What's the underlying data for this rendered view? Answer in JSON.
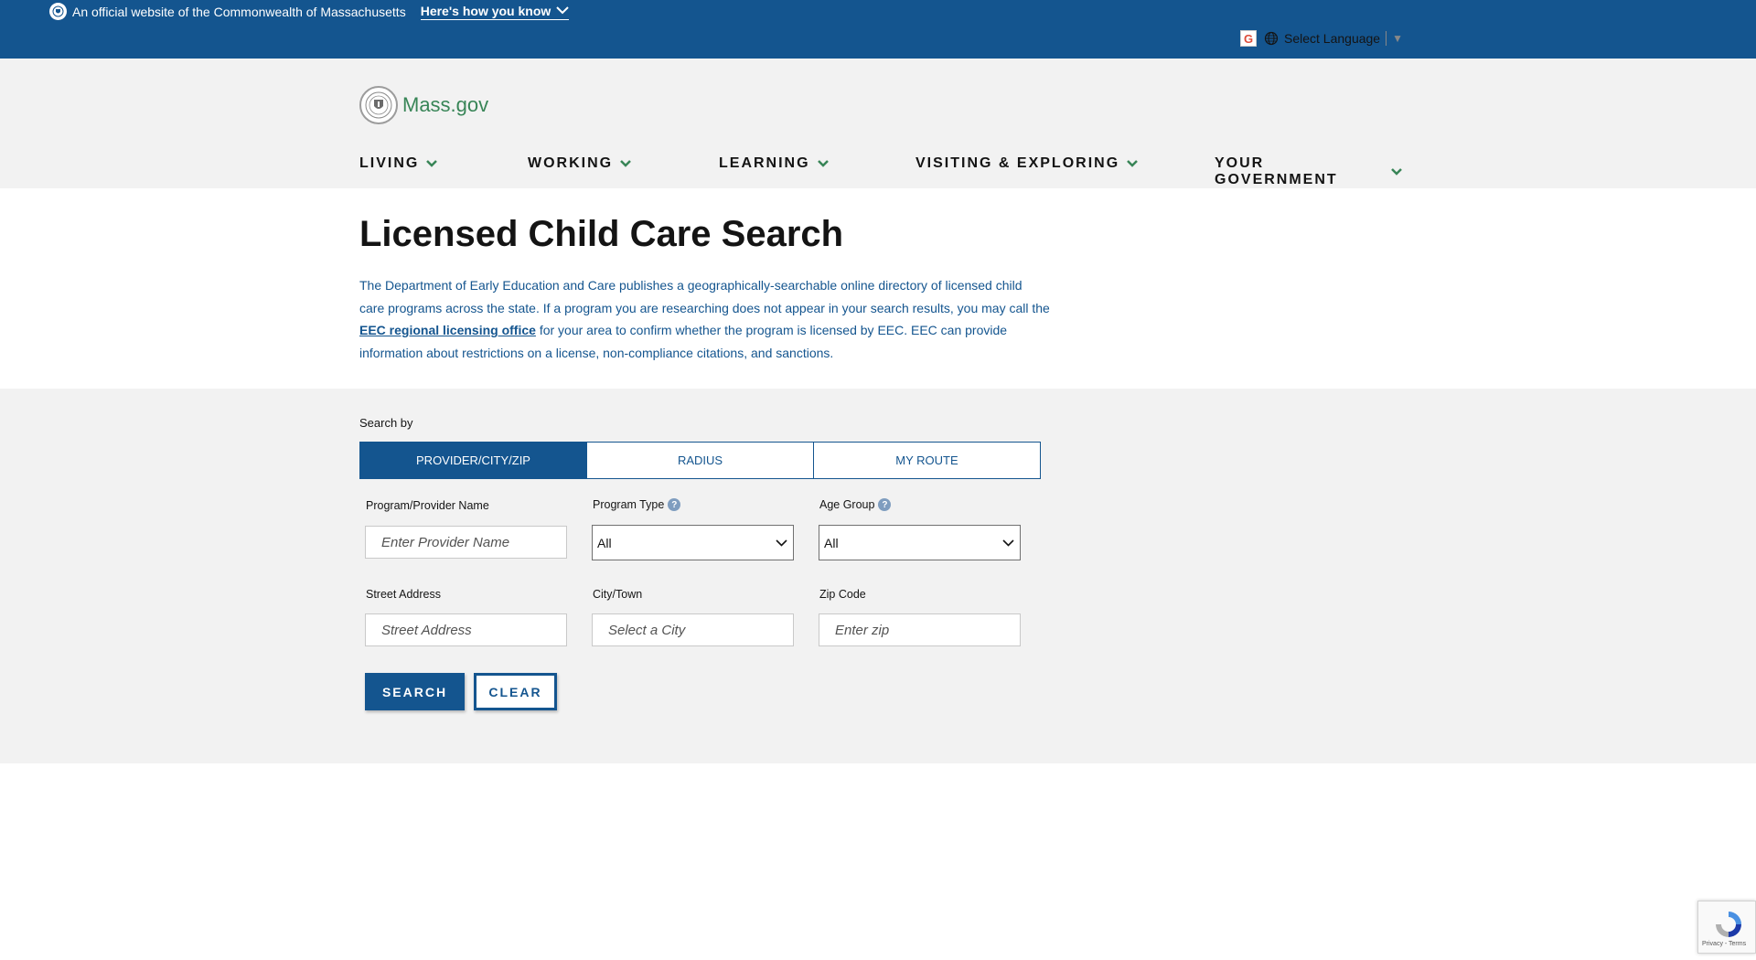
{
  "banner": {
    "official_text": "An official website of the Commonwealth of Massachusetts",
    "how_know": "Here's how you know",
    "language_label": "Select Language"
  },
  "header": {
    "logo_text": "Mass.gov",
    "nav": [
      {
        "label": "LIVING"
      },
      {
        "label": "WORKING"
      },
      {
        "label": "LEARNING"
      },
      {
        "label": "VISITING & EXPLORING"
      },
      {
        "label": "YOUR GOVERNMENT"
      }
    ]
  },
  "main": {
    "title": "Licensed Child Care Search",
    "intro_before": "The Department of Early Education and Care publishes a geographically-searchable online directory of licensed child care programs across the state. If a program you are researching does not appear in your search results, you may call the ",
    "intro_link": "EEC regional licensing office",
    "intro_after": " for your area to confirm whether the program is licensed by EEC. EEC can provide information about restrictions on a license, non-compliance citations, and sanctions."
  },
  "search": {
    "search_by": "Search by",
    "tabs": [
      {
        "label": "PROVIDER/CITY/ZIP",
        "active": true
      },
      {
        "label": "RADIUS",
        "active": false
      },
      {
        "label": "MY ROUTE",
        "active": false
      }
    ],
    "provider_label": "Program/Provider Name",
    "provider_placeholder": "Enter Provider Name",
    "program_type_label": "Program Type",
    "program_type_value": "All",
    "age_group_label": "Age Group",
    "age_group_value": "All",
    "street_label": "Street Address",
    "street_placeholder": "Street Address",
    "city_label": "City/Town",
    "city_placeholder": "Select a City",
    "zip_label": "Zip Code",
    "zip_placeholder": "Enter zip",
    "search_button": "SEARCH",
    "clear_button": "CLEAR"
  },
  "recaptcha": {
    "text": "Privacy - Terms"
  },
  "colors": {
    "primary_blue": "#14558f",
    "brand_green": "#388557",
    "panel_gray": "#f2f2f2"
  }
}
